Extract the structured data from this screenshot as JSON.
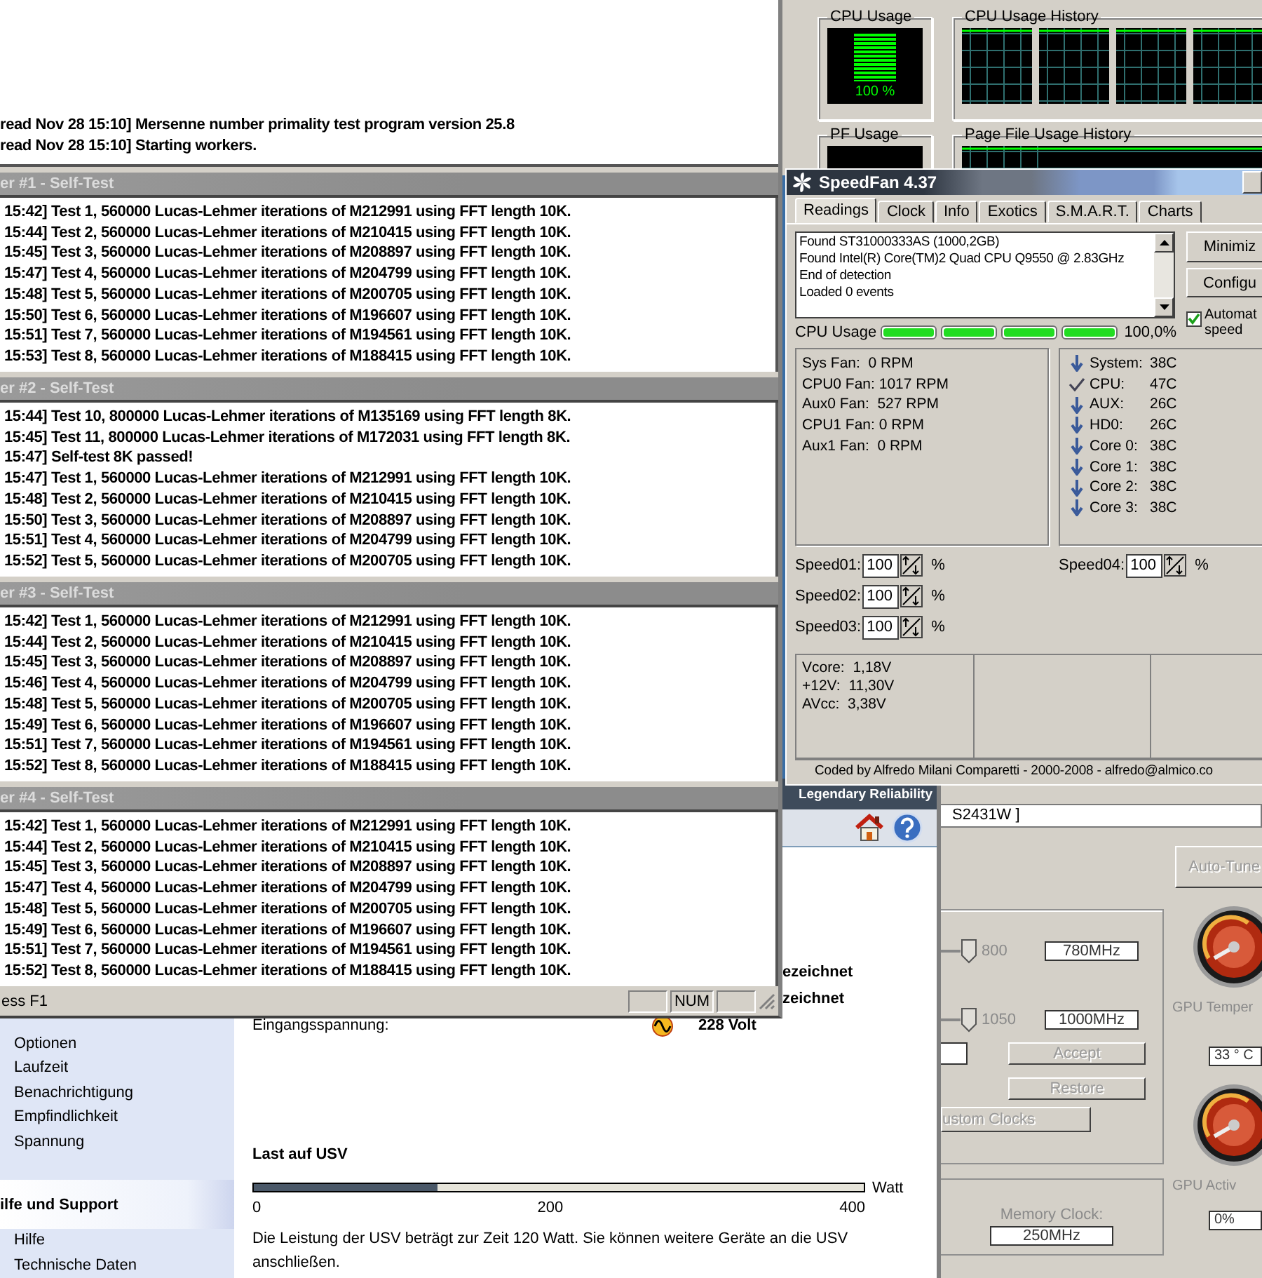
{
  "prime95": {
    "log": [
      "read Nov 28 15:10] Mersenne number primality test program version 25.8",
      "read Nov 28 15:10] Starting workers."
    ],
    "workers": [
      {
        "title": "er #1 - Self-Test",
        "lines": [
          "15:42] Test 1, 560000 Lucas-Lehmer iterations of M212991 using FFT length 10K.",
          "15:44] Test 2, 560000 Lucas-Lehmer iterations of M210415 using FFT length 10K.",
          "15:45] Test 3, 560000 Lucas-Lehmer iterations of M208897 using FFT length 10K.",
          "15:47] Test 4, 560000 Lucas-Lehmer iterations of M204799 using FFT length 10K.",
          "15:48] Test 5, 560000 Lucas-Lehmer iterations of M200705 using FFT length 10K.",
          "15:50] Test 6, 560000 Lucas-Lehmer iterations of M196607 using FFT length 10K.",
          "15:51] Test 7, 560000 Lucas-Lehmer iterations of M194561 using FFT length 10K.",
          "15:53] Test 8, 560000 Lucas-Lehmer iterations of M188415 using FFT length 10K."
        ]
      },
      {
        "title": "er #2 - Self-Test",
        "lines": [
          "15:44] Test 10, 800000 Lucas-Lehmer iterations of M135169 using FFT length 8K.",
          "15:45] Test 11, 800000 Lucas-Lehmer iterations of M172031 using FFT length 8K.",
          "15:47] Self-test 8K passed!",
          "15:47] Test 1, 560000 Lucas-Lehmer iterations of M212991 using FFT length 10K.",
          "15:48] Test 2, 560000 Lucas-Lehmer iterations of M210415 using FFT length 10K.",
          "15:50] Test 3, 560000 Lucas-Lehmer iterations of M208897 using FFT length 10K.",
          "15:51] Test 4, 560000 Lucas-Lehmer iterations of M204799 using FFT length 10K.",
          "15:52] Test 5, 560000 Lucas-Lehmer iterations of M200705 using FFT length 10K."
        ]
      },
      {
        "title": "er #3 - Self-Test",
        "lines": [
          "15:42] Test 1, 560000 Lucas-Lehmer iterations of M212991 using FFT length 10K.",
          "15:44] Test 2, 560000 Lucas-Lehmer iterations of M210415 using FFT length 10K.",
          "15:45] Test 3, 560000 Lucas-Lehmer iterations of M208897 using FFT length 10K.",
          "15:46] Test 4, 560000 Lucas-Lehmer iterations of M204799 using FFT length 10K.",
          "15:48] Test 5, 560000 Lucas-Lehmer iterations of M200705 using FFT length 10K.",
          "15:49] Test 6, 560000 Lucas-Lehmer iterations of M196607 using FFT length 10K.",
          "15:51] Test 7, 560000 Lucas-Lehmer iterations of M194561 using FFT length 10K.",
          "15:52] Test 8, 560000 Lucas-Lehmer iterations of M188415 using FFT length 10K."
        ]
      },
      {
        "title": "er #4 - Self-Test",
        "lines": [
          "15:42] Test 1, 560000 Lucas-Lehmer iterations of M212991 using FFT length 10K.",
          "15:44] Test 2, 560000 Lucas-Lehmer iterations of M210415 using FFT length 10K.",
          "15:45] Test 3, 560000 Lucas-Lehmer iterations of M208897 using FFT length 10K.",
          "15:47] Test 4, 560000 Lucas-Lehmer iterations of M204799 using FFT length 10K.",
          "15:48] Test 5, 560000 Lucas-Lehmer iterations of M200705 using FFT length 10K.",
          "15:49] Test 6, 560000 Lucas-Lehmer iterations of M196607 using FFT length 10K.",
          "15:51] Test 7, 560000 Lucas-Lehmer iterations of M194561 using FFT length 10K.",
          "15:52] Test 8, 560000 Lucas-Lehmer iterations of M188415 using FFT length 10K."
        ]
      }
    ],
    "status_bar": {
      "hint": "ess F1",
      "num_lock": "NUM"
    }
  },
  "task_manager": {
    "cpu_usage": {
      "title": "CPU Usage",
      "reading": "100 %",
      "level": 1
    },
    "cpu_history_title": "CPU Usage History",
    "pf_usage_title": "PF Usage",
    "pf_history_title": "Page File Usage History"
  },
  "speedfan": {
    "title": "SpeedFan 4.37",
    "tabs": [
      {
        "label": "Readings",
        "selected": true
      },
      {
        "label": "Clock",
        "selected": false
      },
      {
        "label": "Info",
        "selected": false
      },
      {
        "label": "Exotics",
        "selected": false
      },
      {
        "label": "S.M.A.R.T.",
        "selected": false
      },
      {
        "label": "Charts",
        "selected": false
      }
    ],
    "log": [
      "Found ST31000333AS (1000,2GB)",
      "Found Intel(R) Core(TM)2 Quad CPU Q9550 @ 2.83GHz",
      "End of detection",
      "Loaded 0 events"
    ],
    "buttons": [
      "Minimiz",
      "Configu"
    ],
    "auto_speed": {
      "label_lines": [
        "Automat",
        "speed"
      ],
      "checked": true
    },
    "cpu_usage": {
      "label": "CPU Usage",
      "cores": [
        {
          "level": 1
        },
        {
          "level": 1
        },
        {
          "level": 1
        },
        {
          "level": 1
        }
      ],
      "reading": "100,0%"
    },
    "fans": [
      "Sys Fan:  0 RPM",
      "CPU0 Fan: 1017 RPM",
      "Aux0 Fan:  527 RPM",
      "CPU1 Fan: 0 RPM",
      "Aux1 Fan:  0 RPM"
    ],
    "temps": [
      {
        "kind": "down",
        "label": "System:",
        "value": "38C"
      },
      {
        "kind": "check",
        "label": "CPU:",
        "value": "47C"
      },
      {
        "kind": "down",
        "label": "AUX:",
        "value": "26C"
      },
      {
        "kind": "down",
        "label": "HD0:",
        "value": "26C"
      },
      {
        "kind": "down",
        "label": "Core 0:",
        "value": "38C"
      },
      {
        "kind": "down",
        "label": "Core 1:",
        "value": "38C"
      },
      {
        "kind": "down",
        "label": "Core 2:",
        "value": "38C"
      },
      {
        "kind": "down",
        "label": "Core 3:",
        "value": "38C"
      }
    ],
    "speed_columns": [
      [
        {
          "label": "Speed01:",
          "value": "100",
          "unit": "%"
        },
        {
          "label": "Speed02:",
          "value": "100",
          "unit": "%"
        },
        {
          "label": "Speed03:",
          "value": "100",
          "unit": "%"
        }
      ],
      [
        {
          "label": "Speed04:",
          "value": "100",
          "unit": "%"
        }
      ]
    ],
    "voltages": [
      {
        "label": "Vcore:",
        "value": "1,18V"
      },
      {
        "label": "+12V:",
        "value": "11,30V"
      },
      {
        "label": "AVcc:",
        "value": "3,38V"
      }
    ],
    "footer": "Coded by Alfredo Milani Comparetti - 2000-2008 - alfredo@almico.co"
  },
  "gpu_tool": {
    "display_field": "S2431W ]",
    "auto_tune": {
      "label": "Auto-Tune",
      "disabled": true
    },
    "clocks": [
      {
        "max": "800",
        "value": "780MHz"
      },
      {
        "max": "1050",
        "value": "1000MHz"
      }
    ],
    "buttons": [
      {
        "label": "Accept",
        "disabled": true
      },
      {
        "label": "Restore",
        "disabled": true
      }
    ],
    "custom_clocks": {
      "label": "ustom Clocks",
      "disabled": true
    },
    "memory_clock": {
      "label": "Memory Clock:",
      "value": "250MHz"
    },
    "gauges": [
      {
        "label": "GPU Temper",
        "reading": "33 ° C"
      },
      {
        "label": "GPU Activ",
        "reading": "0%"
      }
    ]
  },
  "ups": {
    "tagline": "Legendary Reliability",
    "status_values": [
      "ezeichnet",
      "zeichnet"
    ],
    "input_voltage": {
      "label": "Eingangsspannung:",
      "value": "228 Volt"
    },
    "sidebar": {
      "items": [
        "Optionen",
        "Laufzeit",
        "Benachrichtigung",
        "Empfindlichkeit",
        "Spannung"
      ],
      "section": "ilfe und Support",
      "help_items": [
        "Hilfe",
        "Technische Daten"
      ]
    },
    "load": {
      "title": "Last auf USV",
      "level": 0.3,
      "unit": "Watt",
      "ticks": [
        "0",
        "200",
        "400"
      ],
      "note": "Die Leistung der USV beträgt zur Zeit 120 Watt. Sie können weitere Geräte an die USV anschließen."
    }
  }
}
